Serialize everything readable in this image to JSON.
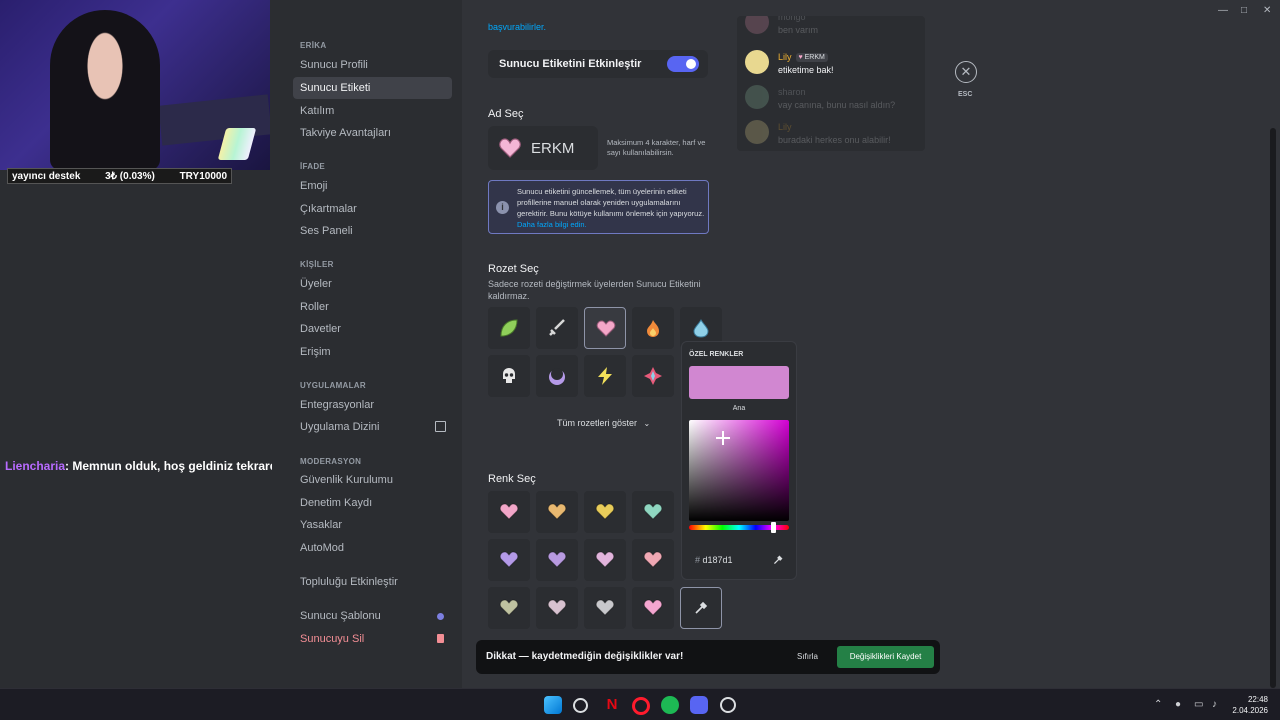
{
  "stream": {
    "donation": {
      "label": "yayıncı destek",
      "amount": "3₺ (0.03%)",
      "goal": "TRY10000"
    },
    "chat": {
      "user": "Liencharia",
      "message": ": Memnun olduk, hoş geldiniz tekrardan"
    }
  },
  "sidebar": {
    "server_name": "ERİKA",
    "items_server": [
      "Sunucu Profili",
      "Sunucu Etiketi",
      "Katılım",
      "Takviye Avantajları"
    ],
    "head_ifade": "İFADE",
    "items_ifade": [
      "Emoji",
      "Çıkartmalar",
      "Ses Paneli"
    ],
    "head_kisiler": "KİŞİLER",
    "items_kisiler": [
      "Üyeler",
      "Roller",
      "Davetler",
      "Erişim"
    ],
    "head_apps": "UYGULAMALAR",
    "items_apps": [
      "Entegrasyonlar",
      "Uygulama Dizini"
    ],
    "head_mod": "MODERASYON",
    "items_mod": [
      "Güvenlik Kurulumu",
      "Denetim Kaydı",
      "Yasaklar",
      "AutoMod"
    ],
    "community": "Topluluğu Etkinleştir",
    "template": "Sunucu Şablonu",
    "delete": "Sunucuyu Sil"
  },
  "main": {
    "top_link": "başvurabilirler.",
    "toggle_label": "Sunucu Etiketini Etkinleştir",
    "toggle_on": true,
    "name_section": "Ad Seç",
    "tag_name": "ERKM",
    "name_hint": "Maksimum 4 karakter, harf ve sayı kullanılabilirsin.",
    "notice_text": "Sunucu etiketini güncellemek, tüm üyelerinin etiketi profillerine manuel olarak yeniden uygulamalarını gerektirir. Bunu kötüye kullanımı önlemek için yapıyoruz.",
    "notice_link": "Daha fazla bilgi edin.",
    "badge_section": "Rozet Seç",
    "badge_hint": "Sadece rozeti değiştirmek üyelerden Sunucu Etiketini kaldırmaz.",
    "badges": [
      "leaf-icon",
      "sword-icon",
      "heart-icon",
      "fire-icon",
      "droplet-icon",
      "skull-icon",
      "moon-icon",
      "lightning-icon",
      "sparkle-icon"
    ],
    "show_all": "Tüm rozetleri göster",
    "color_section": "Renk Seç",
    "colors": [
      "#f2a6c8",
      "#e8b870",
      "#e8cc5a",
      "#8fd6c0",
      "#b49ae8",
      "#b89ae0",
      "#e2b4dc",
      "#f0a8b4",
      "#bfc2a0",
      "#d8c2d0",
      "#c8c8cc",
      "#f4a6d0"
    ]
  },
  "picker": {
    "title": "ÖZEL RENKLER",
    "label": "Ana",
    "hex": "d187d1",
    "hash": "#",
    "color": "#d187d1"
  },
  "savebar": {
    "message": "Dikkat — kaydetmediğin değişiklikler var!",
    "reset": "Sıfırla",
    "save": "Değişiklikleri Kaydet"
  },
  "preview": {
    "messages": [
      {
        "name": "mongo",
        "text": "ben varım",
        "faded": true
      },
      {
        "name": "Lily",
        "tag": "ERKM",
        "text": "etiketime bak!",
        "faded": false
      },
      {
        "name": "sharon",
        "text": "vay canına, bunu nasıl aldın?",
        "faded": true
      },
      {
        "name": "Lily",
        "text": "buradaki herkes onu alabilir!",
        "faded": true
      }
    ]
  },
  "esc_label": "ESC",
  "taskbar": {
    "time": "22:48",
    "date": "2.04.2026"
  }
}
